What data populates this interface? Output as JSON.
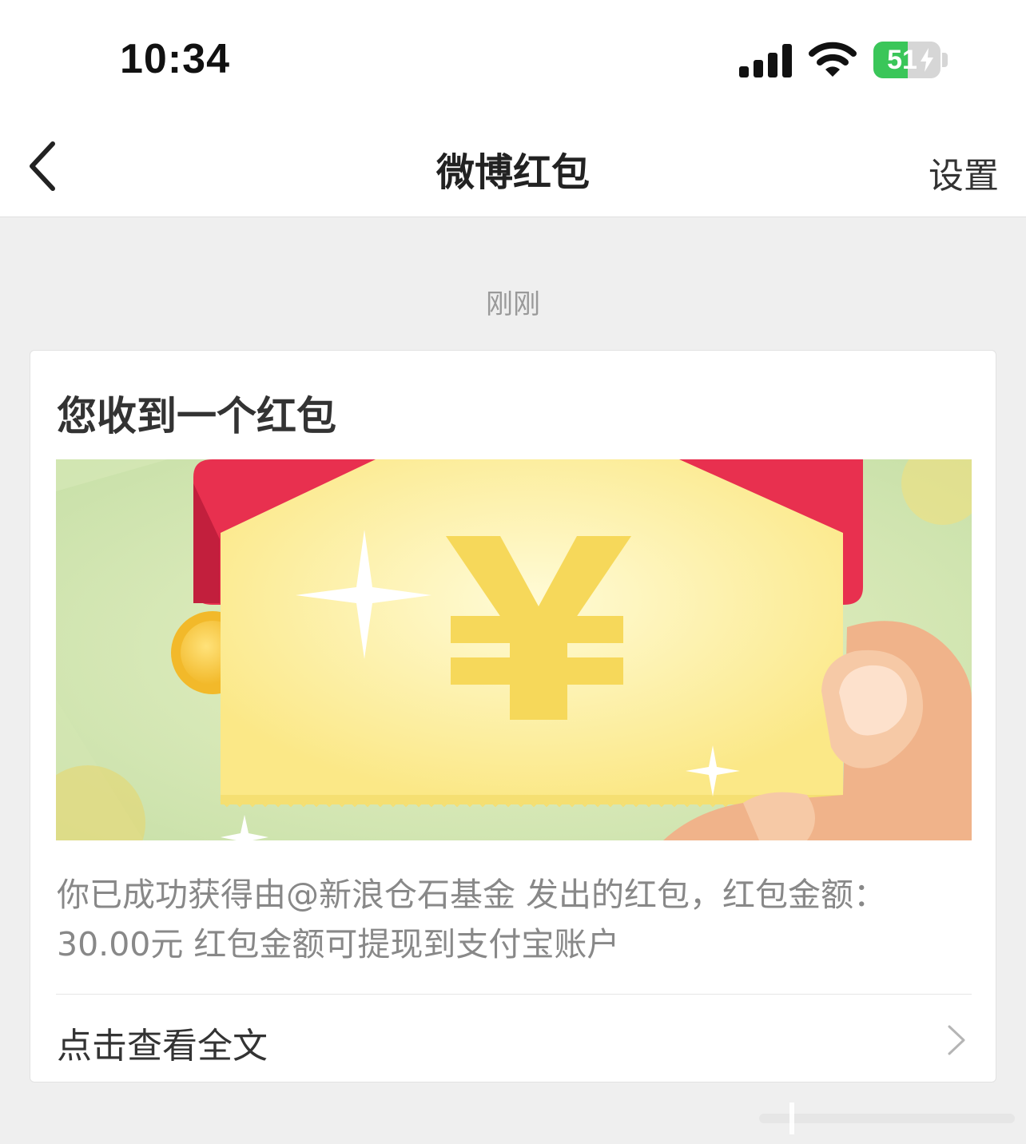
{
  "status_bar": {
    "time": "10:34",
    "battery_level": "51",
    "battery_percent": 51,
    "battery_charging": true,
    "signal_icon": "cellular-signal-icon",
    "wifi_icon": "wifi-icon"
  },
  "nav": {
    "title": "微博红包",
    "right_action": "设置",
    "back_icon": "chevron-left-icon"
  },
  "message": {
    "timestamp": "刚刚",
    "title": "您收到一个红包",
    "image": "red-envelope-illustration",
    "body": "你已成功获得由@新浪仓石基金 发出的红包，红包金额：30.00元 红包金额可提现到支付宝账户",
    "link_label": "点击查看全文",
    "link_icon": "chevron-right-icon"
  },
  "colors": {
    "page_background": "#efefef",
    "card_background": "#ffffff",
    "envelope_red": "#e8304f",
    "envelope_yellow": "#fce983",
    "battery_green": "#3ac659"
  }
}
